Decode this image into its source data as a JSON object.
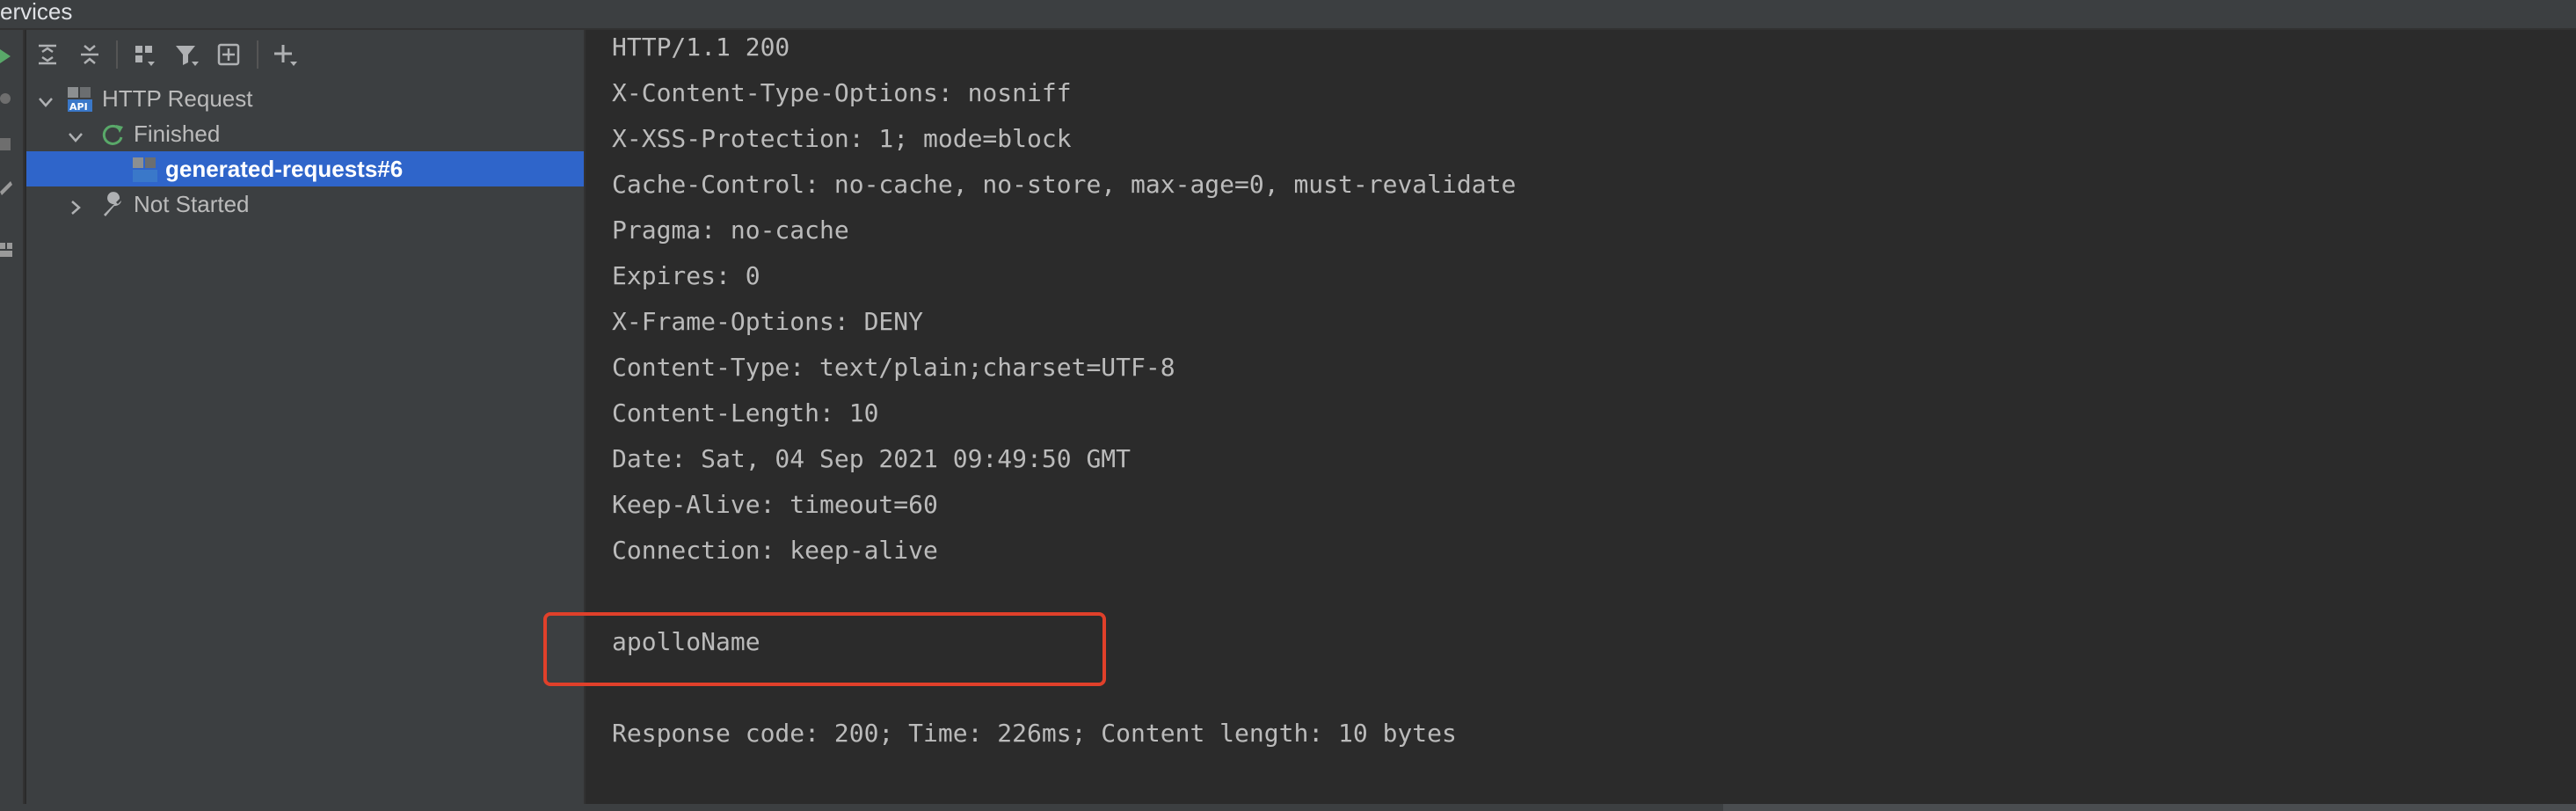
{
  "window": {
    "title": "Services"
  },
  "toolbar": {
    "buttons": [
      "expand-all",
      "collapse-all",
      "group-by",
      "filter",
      "add-service",
      "add"
    ]
  },
  "tree": {
    "root": {
      "label": "HTTP Request",
      "icon": "api-icon"
    },
    "groups": [
      {
        "label": "Finished",
        "icon": "finished-icon",
        "children": [
          {
            "label": "generated-requests#6",
            "icon": "http-request-file-icon",
            "selected": true
          }
        ]
      },
      {
        "label": "Not Started",
        "icon": "wrench-icon",
        "children": []
      }
    ]
  },
  "response": {
    "lines": [
      "HTTP/1.1 200",
      "X-Content-Type-Options: nosniff",
      "X-XSS-Protection: 1; mode=block",
      "Cache-Control: no-cache, no-store, max-age=0, must-revalidate",
      "Pragma: no-cache",
      "Expires: 0",
      "X-Frame-Options: DENY",
      "Content-Type: text/plain;charset=UTF-8",
      "Content-Length: 10",
      "Date: Sat, 04 Sep 2021 09:49:50 GMT",
      "Keep-Alive: timeout=60",
      "Connection: keep-alive"
    ],
    "body": "apolloName",
    "summary": "Response code: 200; Time: 226ms; Content length: 10 bytes"
  },
  "colors": {
    "selection": "#2f65ca",
    "highlight_box": "#e0402a",
    "run_green": "#59a869"
  }
}
